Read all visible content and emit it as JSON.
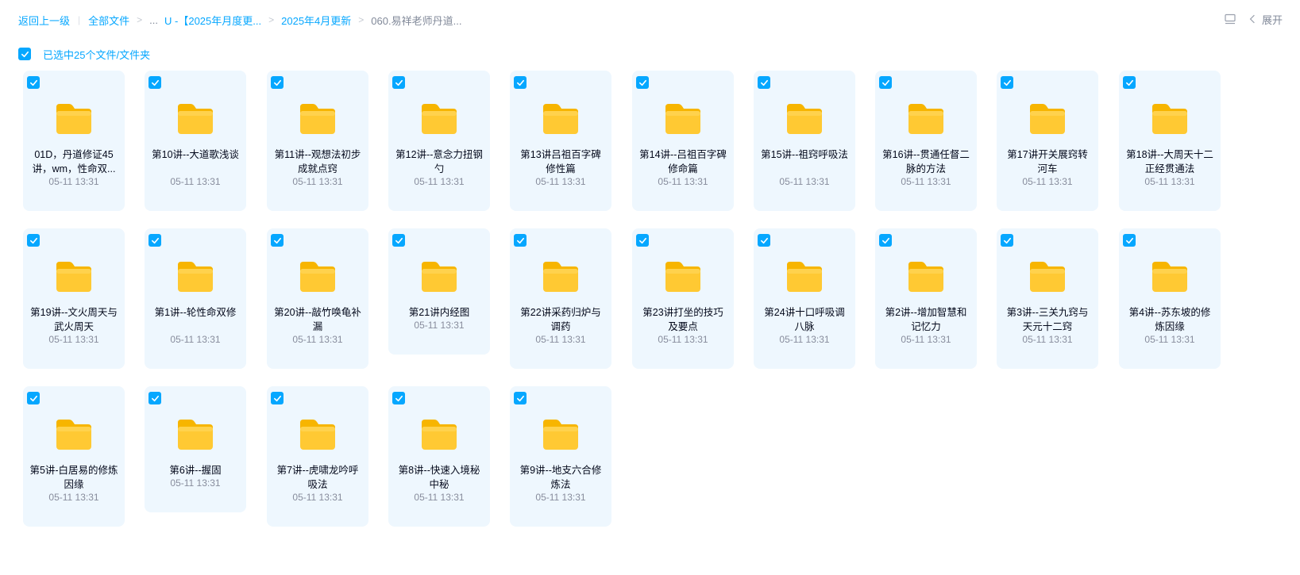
{
  "breadcrumb": {
    "back": "返回上一级",
    "all_files": "全部文件",
    "ellipsis": "...",
    "level1": "U -【2025年月度更...",
    "level2": "2025年4月更新",
    "current": "060.易祥老师丹道..."
  },
  "toolbar": {
    "expand_label": "展开"
  },
  "selection": {
    "label": "已选中25个文件/文件夹",
    "checked": true
  },
  "colors": {
    "accent": "#06a7ff",
    "card_bg": "#eef7fe",
    "folder_yellow": "#ffc933"
  },
  "files": [
    {
      "name": "01D，丹道修证45讲，wm，性命双...",
      "date": "05-11 13:31",
      "checked": true
    },
    {
      "name": "第10讲--大道歌浅谈",
      "date": "05-11 13:31",
      "checked": true
    },
    {
      "name": "第11讲--观想法初步成就点窍",
      "date": "05-11 13:31",
      "checked": true
    },
    {
      "name": "第12讲--意念力扭钢勺",
      "date": "05-11 13:31",
      "checked": true
    },
    {
      "name": "第13讲吕祖百字碑修性篇",
      "date": "05-11 13:31",
      "checked": true
    },
    {
      "name": "第14讲--吕祖百字碑修命篇",
      "date": "05-11 13:31",
      "checked": true
    },
    {
      "name": "第15讲--祖窍呼吸法",
      "date": "05-11 13:31",
      "checked": true
    },
    {
      "name": "第16讲--贯通任督二脉的方法",
      "date": "05-11 13:31",
      "checked": true
    },
    {
      "name": "第17讲开关展窍转河车",
      "date": "05-11 13:31",
      "checked": true
    },
    {
      "name": "第18讲--大周天十二正经贯通法",
      "date": "05-11 13:31",
      "checked": true
    },
    {
      "name": "第19讲--文火周天与武火周天",
      "date": "05-11 13:31",
      "checked": true
    },
    {
      "name": "第1讲--轮性命双修",
      "date": "05-11 13:31",
      "checked": true
    },
    {
      "name": "第20讲--敲竹唤龟补漏",
      "date": "05-11 13:31",
      "checked": true
    },
    {
      "name": "第21讲内经图",
      "date": "05-11 13:31",
      "checked": true
    },
    {
      "name": "第22讲采药归炉与调药",
      "date": "05-11 13:31",
      "checked": true
    },
    {
      "name": "第23讲打坐的技巧及要点",
      "date": "05-11 13:31",
      "checked": true
    },
    {
      "name": "第24讲十口呼吸调八脉",
      "date": "05-11 13:31",
      "checked": true
    },
    {
      "name": "第2讲--增加智慧和记忆力",
      "date": "05-11 13:31",
      "checked": true
    },
    {
      "name": "第3讲--三关九窍与天元十二窍",
      "date": "05-11 13:31",
      "checked": true
    },
    {
      "name": "第4讲--苏东坡的修炼因缘",
      "date": "05-11 13:31",
      "checked": true
    },
    {
      "name": "第5讲-白居易的修炼因缘",
      "date": "05-11 13:31",
      "checked": true
    },
    {
      "name": "第6讲--握固",
      "date": "05-11 13:31",
      "checked": true
    },
    {
      "name": "第7讲--虎啸龙吟呼吸法",
      "date": "05-11 13:31",
      "checked": true
    },
    {
      "name": "第8讲--快速入境秘中秘",
      "date": "05-11 13:31",
      "checked": true
    },
    {
      "name": "第9讲--地支六合修炼法",
      "date": "05-11 13:31",
      "checked": true
    }
  ]
}
